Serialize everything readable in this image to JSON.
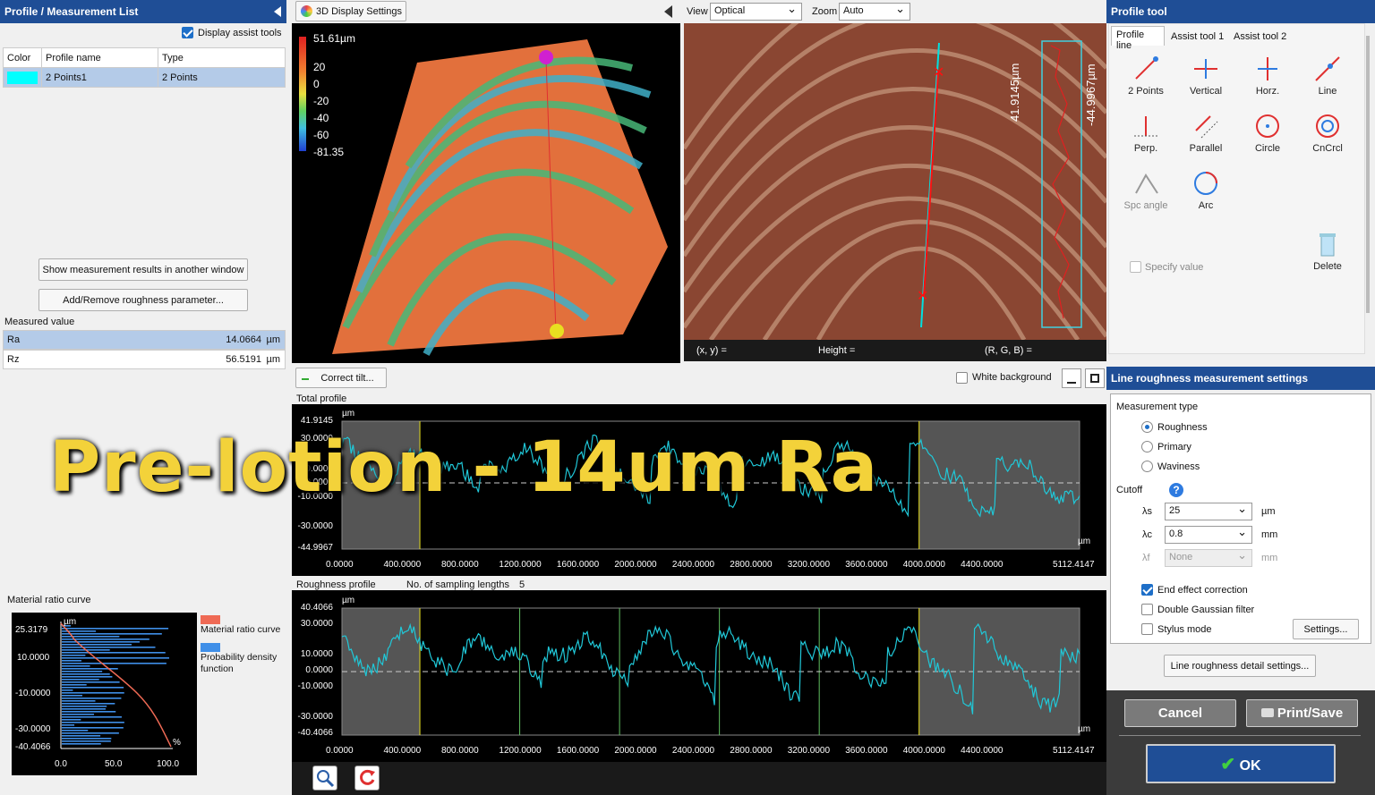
{
  "left_panel": {
    "title": "Profile / Measurement List",
    "display_assist": "Display assist tools",
    "table_headers": [
      "Color",
      "Profile name",
      "Type"
    ],
    "rows": [
      {
        "color": "#00ffff",
        "name": "2 Points1",
        "type": "2 Points"
      }
    ],
    "show_results_btn": "Show measurement results in another window",
    "add_remove_btn": "Add/Remove roughness parameter...",
    "measured_label": "Measured value",
    "measured": [
      {
        "name": "Ra",
        "value": "14.0664",
        "unit": "µm"
      },
      {
        "name": "Rz",
        "value": "56.5191",
        "unit": "µm"
      }
    ],
    "material_title": "Material ratio curve",
    "material_legend": [
      {
        "label": "Material ratio curve",
        "color": "#ef6a55"
      },
      {
        "label": "Probability density function",
        "color": "#3f8fe8"
      }
    ],
    "material_y_ticks": [
      "25.3179",
      "10.0000",
      "-10.0000",
      "-30.0000",
      "-40.4066"
    ],
    "material_x_ticks": [
      "0.0",
      "50.0",
      "100.0"
    ],
    "material_unit": "µm",
    "material_pct": "%"
  },
  "view3d": {
    "settings_btn": "3D Display Settings",
    "scale_max": "51.61µm",
    "scale_ticks": [
      "20",
      "0",
      "-20",
      "-40",
      "-60",
      "-81.35"
    ]
  },
  "optical": {
    "view_label": "View",
    "view_value": "Optical",
    "zoom_label": "Zoom",
    "zoom_value": "Auto",
    "status_xy": "(x, y)  =",
    "status_height": "Height  =",
    "status_rgb": "(R, G, B)  =",
    "profile_max": "41.9145µm",
    "profile_min": "-44.9967µm"
  },
  "profile_tool": {
    "title": "Profile tool",
    "tabs": [
      "Profile line",
      "Assist tool 1",
      "Assist tool 2"
    ],
    "tools": [
      "2 Points",
      "Vertical",
      "Horz.",
      "Line",
      "Perp.",
      "Parallel",
      "Circle",
      "CnCrcl",
      "Spc angle",
      "Arc"
    ],
    "specify": "Specify value",
    "delete": "Delete"
  },
  "charts_toolbar": {
    "correct_tilt": "Correct tilt...",
    "white_bg": "White background"
  },
  "chart_data": [
    {
      "type": "line",
      "title": "Total profile",
      "unit": "µm",
      "ymax_label": "41.9145",
      "ymin_label": "-44.9967",
      "y_ticks": [
        "30.0000",
        "10.0000",
        "0.0000",
        "-10.0000",
        "-30.0000"
      ],
      "x_ticks": [
        "0.0000",
        "400.0000",
        "800.0000",
        "1200.0000",
        "1600.0000",
        "2000.0000",
        "2400.0000",
        "2800.0000",
        "3200.0000",
        "3600.0000",
        "4000.0000",
        "4400.0000"
      ],
      "xmax_label": "5112.4147",
      "xlim": [
        0,
        5112.4147
      ],
      "ylim": [
        -44.9967,
        41.9145
      ]
    },
    {
      "type": "line",
      "title": "Roughness profile",
      "sampling_label": "No. of sampling lengths",
      "sampling_value": "5",
      "unit": "µm",
      "ymax_label": "40.4066",
      "ymin_label": "-40.4066",
      "y_ticks": [
        "30.0000",
        "10.0000",
        "0.0000",
        "-10.0000",
        "-30.0000"
      ],
      "x_ticks": [
        "0.0000",
        "400.0000",
        "800.0000",
        "1200.0000",
        "1600.0000",
        "2000.0000",
        "2400.0000",
        "2800.0000",
        "3200.0000",
        "3600.0000",
        "4000.0000",
        "4400.0000"
      ],
      "xmax_label": "5112.4147",
      "xlim": [
        0,
        5112.4147
      ],
      "ylim": [
        -40.4066,
        40.4066
      ]
    }
  ],
  "settings": {
    "title": "Line roughness measurement settings",
    "mtype_label": "Measurement type",
    "types": [
      "Roughness",
      "Primary",
      "Waviness"
    ],
    "cutoff": "Cutoff",
    "ls_label": "λs",
    "ls_value": "25",
    "ls_unit": "µm",
    "lc_label": "λc",
    "lc_value": "0.8",
    "lc_unit": "mm",
    "lf_label": "λf",
    "lf_value": "None",
    "lf_unit": "mm",
    "end_effect": "End effect correction",
    "double_gauss": "Double Gaussian filter",
    "stylus": "Stylus mode",
    "settings_btn": "Settings...",
    "detail_btn": "Line roughness detail settings...",
    "cancel": "Cancel",
    "print_save": "Print/Save",
    "ok": "OK"
  },
  "overlay": {
    "text": "Pre-lotion - 14um Ra"
  }
}
